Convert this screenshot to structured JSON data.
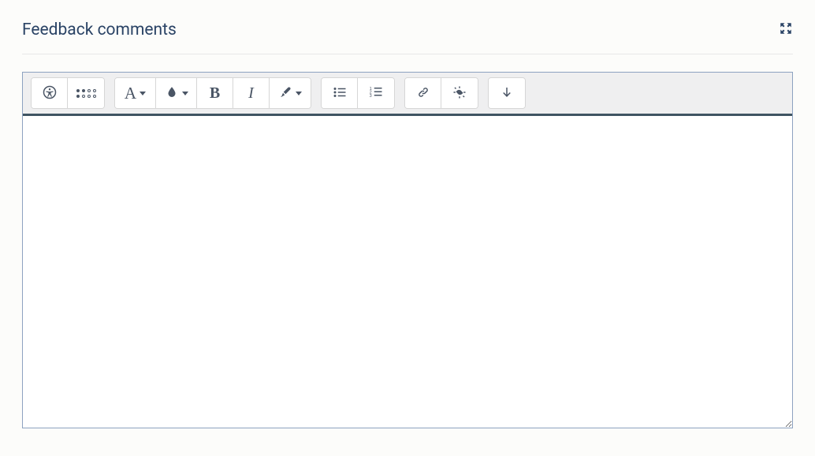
{
  "header": {
    "title": "Feedback comments"
  },
  "editor": {
    "content": ""
  }
}
